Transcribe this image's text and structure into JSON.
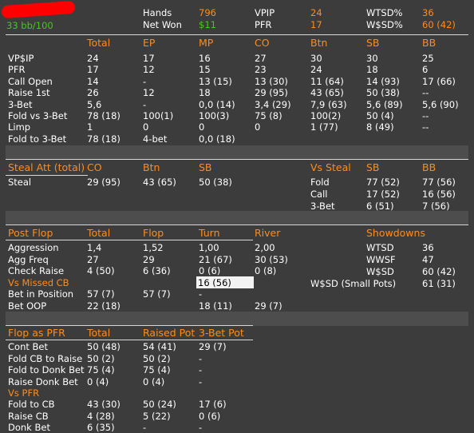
{
  "player": {
    "stack": "33 bb/100"
  },
  "summary": {
    "hands_label": "Hands",
    "hands_value": "796",
    "netwon_label": "Net Won",
    "netwon_value": "$11",
    "vpip_label": "VPIP",
    "vpip_value": "24",
    "pfr_label": "PFR",
    "pfr_value": "17",
    "wtsd_label": "WTSD%",
    "wtsd_value": "36",
    "wssd_label": "W$SD%",
    "wssd_value": "60 (42)"
  },
  "preflop": {
    "headers": [
      "Total",
      "EP",
      "MP",
      "CO",
      "Btn",
      "SB",
      "BB"
    ],
    "rows": [
      {
        "label": "VP$IP",
        "cells": [
          "24",
          "17",
          "16",
          "27",
          "30",
          "30",
          "25"
        ]
      },
      {
        "label": "PFR",
        "cells": [
          "17",
          "12",
          "15",
          "23",
          "24",
          "18",
          "6"
        ]
      },
      {
        "label": "Call Open",
        "cells": [
          "14",
          "-",
          "13 (15)",
          "13 (30)",
          "11 (64)",
          "14 (93)",
          "17 (66)"
        ]
      },
      {
        "label": "Raise 1st",
        "cells": [
          "26",
          "12",
          "18",
          "29 (95)",
          "43 (65)",
          "50 (38)",
          "--"
        ]
      },
      {
        "label": "3-Bet",
        "cells": [
          "5,6",
          "-",
          "0,0 (14)",
          "3,4 (29)",
          "7,9 (63)",
          "5,6 (89)",
          "5,6 (90)"
        ]
      },
      {
        "label": "Fold vs 3-Bet",
        "cells": [
          "78 (18)",
          "100(1)",
          "100(3)",
          "75 (8)",
          "100(2)",
          "50 (4)",
          "--"
        ]
      },
      {
        "label": "Limp",
        "cells": [
          "1",
          "0",
          "0",
          "0",
          "1 (77)",
          "8 (49)",
          "--"
        ]
      },
      {
        "label": "Fold to 3-Bet",
        "cells": [
          "78 (18)",
          "4-bet",
          "0,0 (18)",
          "",
          "",
          "",
          ""
        ]
      }
    ]
  },
  "steal": {
    "title": "Steal Att (total)",
    "headers": [
      "CO",
      "Btn",
      "SB"
    ],
    "row": {
      "label": "Steal",
      "cells": [
        "29 (95)",
        "43 (65)",
        "50 (38)"
      ]
    },
    "vs_title": "Vs Steal",
    "vs_headers": [
      "SB",
      "BB"
    ],
    "vs_rows": [
      {
        "label": "Fold",
        "cells": [
          "77 (52)",
          "77 (56)"
        ]
      },
      {
        "label": "Call",
        "cells": [
          "17 (52)",
          "16 (56)"
        ]
      },
      {
        "label": "3-Bet",
        "cells": [
          "6 (51)",
          "7 (56)"
        ]
      }
    ]
  },
  "postflop": {
    "title": "Post Flop",
    "headers": [
      "Total",
      "Flop",
      "Turn",
      "River"
    ],
    "rows": [
      {
        "label": "Aggression",
        "cells": [
          "1,4",
          "1,52",
          "1,00",
          "2,00"
        ]
      },
      {
        "label": "Agg Freq",
        "cells": [
          "27",
          "29",
          "21 (67)",
          "30 (53)"
        ]
      },
      {
        "label": "Check Raise",
        "cells": [
          "4 (50)",
          "6 (36)",
          "0 (6)",
          "0 (8)"
        ]
      }
    ],
    "vs_missed_cb_label": "Vs Missed CB",
    "vs_missed_cb_turn": "16 (56)",
    "rows2": [
      {
        "label": "Bet in Position",
        "cells": [
          "57 (7)",
          "57 (7)",
          "-",
          ""
        ]
      },
      {
        "label": "Bet OOP",
        "cells": [
          "22 (18)",
          "",
          "18 (11)",
          "29 (7)"
        ]
      }
    ]
  },
  "showdowns": {
    "title": "Showdowns",
    "rows": [
      {
        "label": "WTSD",
        "value": "36"
      },
      {
        "label": "WWSF",
        "value": "47"
      },
      {
        "label": "W$SD",
        "value": "60 (42)"
      },
      {
        "label": "W$SD (Small Pots)",
        "value": "61 (31)"
      }
    ]
  },
  "flop_pfr": {
    "title": "Flop as PFR",
    "headers": [
      "Total",
      "Raised Pot",
      "3-Bet Pot"
    ],
    "rows": [
      {
        "label": "Cont Bet",
        "cells": [
          "50 (48)",
          "54 (41)",
          "29 (7)"
        ]
      },
      {
        "label": "Fold CB to Raise",
        "cells": [
          "50 (2)",
          "50 (2)",
          "-"
        ]
      },
      {
        "label": "Fold to Donk Bet",
        "cells": [
          "75 (4)",
          "75 (4)",
          "-"
        ]
      },
      {
        "label": "Raise Donk Bet",
        "cells": [
          "0 (4)",
          "0 (4)",
          "-"
        ]
      }
    ],
    "vs_title": "Vs PFR",
    "vs_rows": [
      {
        "label": "Fold to CB",
        "cells": [
          "43 (30)",
          "50 (24)",
          "17 (6)"
        ]
      },
      {
        "label": "Raise CB",
        "cells": [
          "4 (28)",
          "5 (22)",
          "0 (6)"
        ]
      },
      {
        "label": "Donk Bet",
        "cells": [
          "6 (35)",
          "-",
          "-"
        ]
      }
    ]
  }
}
